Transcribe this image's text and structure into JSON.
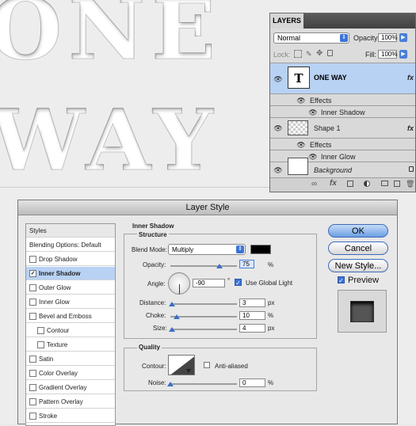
{
  "canvas": {
    "text_line1": "ONE",
    "text_line2": "WAY"
  },
  "layers_panel": {
    "tab": "LAYERS",
    "blend_mode": "Normal",
    "opacity_label": "Opacity:",
    "opacity_value": "100%",
    "lock_label": "Lock:",
    "fill_label": "Fill:",
    "fill_value": "100%",
    "layers": [
      {
        "name": "ONE WAY",
        "thumb": "T",
        "fx": "fx",
        "effects_label": "Effects",
        "effect": "Inner Shadow"
      },
      {
        "name": "Shape 1",
        "fx": "fx",
        "effects_label": "Effects",
        "effect": "Inner Glow"
      },
      {
        "name": "Background"
      }
    ]
  },
  "layer_style": {
    "title": "Layer Style",
    "styles_header": "Styles",
    "styles_items": [
      "Blending Options: Default",
      "Drop Shadow",
      "Inner Shadow",
      "Outer Glow",
      "Inner Glow",
      "Bevel and Emboss",
      "Contour",
      "Texture",
      "Satin",
      "Color Overlay",
      "Gradient Overlay",
      "Pattern Overlay",
      "Stroke"
    ],
    "section_title": "Inner Shadow",
    "structure_title": "Structure",
    "blend_mode_label": "Blend Mode:",
    "blend_mode_value": "Multiply",
    "opacity_label": "Opacity:",
    "opacity_value": "75",
    "angle_label": "Angle:",
    "angle_value": "-90",
    "angle_unit": "°",
    "use_global_light": "Use Global Light",
    "distance_label": "Distance:",
    "distance_value": "3",
    "choke_label": "Choke:",
    "choke_value": "10",
    "size_label": "Size:",
    "size_value": "4",
    "unit_px": "px",
    "unit_pct": "%",
    "quality_title": "Quality",
    "contour_label": "Contour:",
    "anti_aliased": "Anti-aliased",
    "noise_label": "Noise:",
    "noise_value": "0",
    "ok": "OK",
    "cancel": "Cancel",
    "new_style": "New Style...",
    "preview": "Preview",
    "shadow_color": "#000000",
    "accent": "#3d6fc8",
    "selected_row": "#b8d2f4"
  }
}
